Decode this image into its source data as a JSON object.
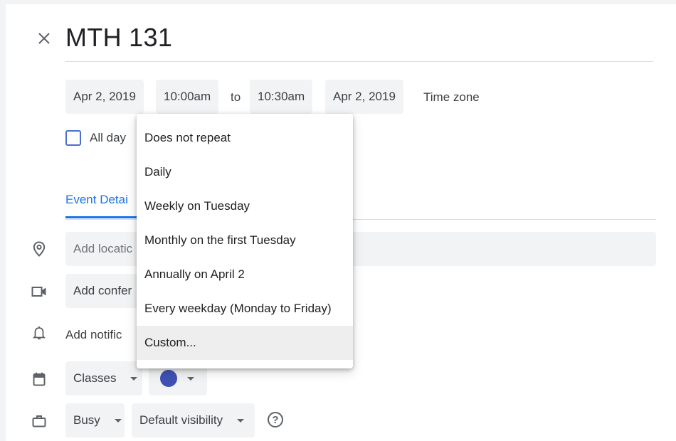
{
  "event": {
    "title": "MTH 131"
  },
  "datetime": {
    "start_date": "Apr 2, 2019",
    "start_time": "10:00am",
    "to_label": "to",
    "end_time": "10:30am",
    "end_date": "Apr 2, 2019",
    "timezone_label": "Time zone"
  },
  "allday": {
    "label": "All day",
    "checked": false
  },
  "tabs": {
    "event_details": "Event Detai"
  },
  "fields": {
    "location_placeholder": "Add locatic",
    "conference_label": "Add confer",
    "notification_label": "Add notific"
  },
  "calendar": {
    "name": "Classes",
    "color": "#3f51b5"
  },
  "status": {
    "busy": "Busy",
    "visibility": "Default visibility",
    "help_glyph": "?"
  },
  "repeat_menu": {
    "items": [
      "Does not repeat",
      "Daily",
      "Weekly on Tuesday",
      "Monthly on the first Tuesday",
      "Annually on April 2",
      "Every weekday (Monday to Friday)",
      "Custom..."
    ],
    "highlighted": "Custom..."
  },
  "icons": {
    "close": "close-icon",
    "location": "location-pin-icon",
    "video": "video-camera-icon",
    "notification": "bell-icon",
    "calendar": "calendar-icon",
    "status": "briefcase-icon",
    "help": "help-icon"
  },
  "colors": {
    "accent": "#1a73e8",
    "checkbox_border": "#4a6fd0"
  }
}
